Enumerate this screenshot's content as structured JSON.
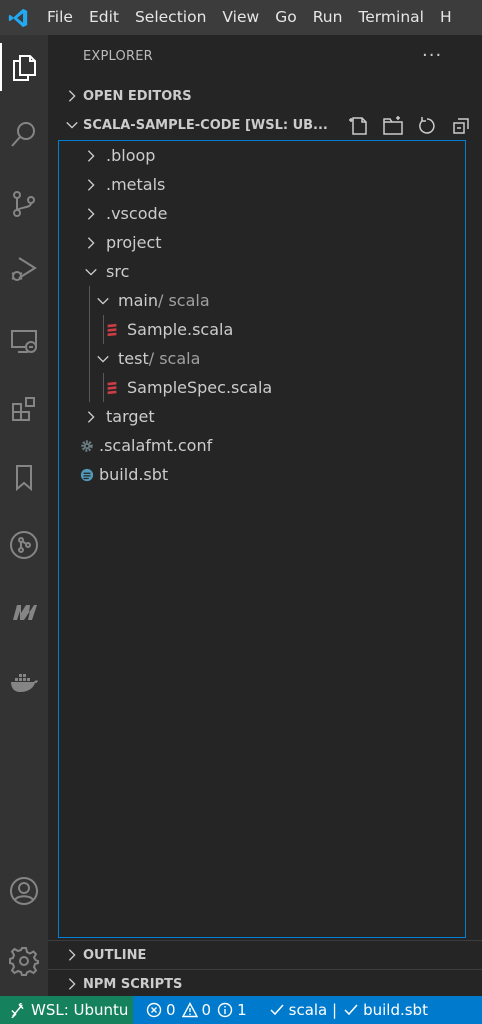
{
  "titlebar": {
    "menu": [
      "File",
      "Edit",
      "Selection",
      "View",
      "Go",
      "Run",
      "Terminal",
      "H"
    ]
  },
  "activitybar": {
    "icons": [
      "files-icon",
      "search-icon",
      "source-control-icon",
      "run-debug-icon",
      "remote-explorer-icon",
      "extensions-icon",
      "bookmarks-icon",
      "gitlens-icon",
      "metals-icon",
      "docker-icon",
      "account-icon",
      "settings-gear-icon"
    ]
  },
  "sidebar": {
    "title": "EXPLORER",
    "more": "···",
    "open_editors": "OPEN EDITORS",
    "workspace": "SCALA-SAMPLE-CODE [WSL: UB...",
    "outline": "OUTLINE",
    "npm_scripts": "NPM SCRIPTS"
  },
  "tree": [
    {
      "label": ".bloop",
      "type": "folder",
      "expanded": false
    },
    {
      "label": ".metals",
      "type": "folder",
      "expanded": false
    },
    {
      "label": ".vscode",
      "type": "folder",
      "expanded": false
    },
    {
      "label": "project",
      "type": "folder",
      "expanded": false
    },
    {
      "label": "src",
      "type": "folder",
      "expanded": true
    },
    {
      "label": "main",
      "suffix": " / scala",
      "type": "folder",
      "expanded": true
    },
    {
      "label": "Sample.scala",
      "type": "scala-file"
    },
    {
      "label": "test",
      "suffix": " / scala",
      "type": "folder",
      "expanded": true
    },
    {
      "label": "SampleSpec.scala",
      "type": "scala-file"
    },
    {
      "label": "target",
      "type": "folder",
      "expanded": false
    },
    {
      "label": ".scalafmt.conf",
      "type": "config-file"
    },
    {
      "label": "build.sbt",
      "type": "sbt-file"
    }
  ],
  "statusbar": {
    "remote": "WSL: Ubuntu",
    "errors": "0",
    "warnings": "0",
    "info": "1",
    "scala": "scala |",
    "build": "build.sbt"
  },
  "colors": {
    "titlebar": "#3c3c3c",
    "activitybar": "#333333",
    "sidebar": "#252526",
    "statusbar": "#007acc",
    "remote": "#16825d",
    "focus_border": "#007fd4",
    "scala_red": "#cc3e44",
    "vscode_blue": "#23a9f2"
  }
}
